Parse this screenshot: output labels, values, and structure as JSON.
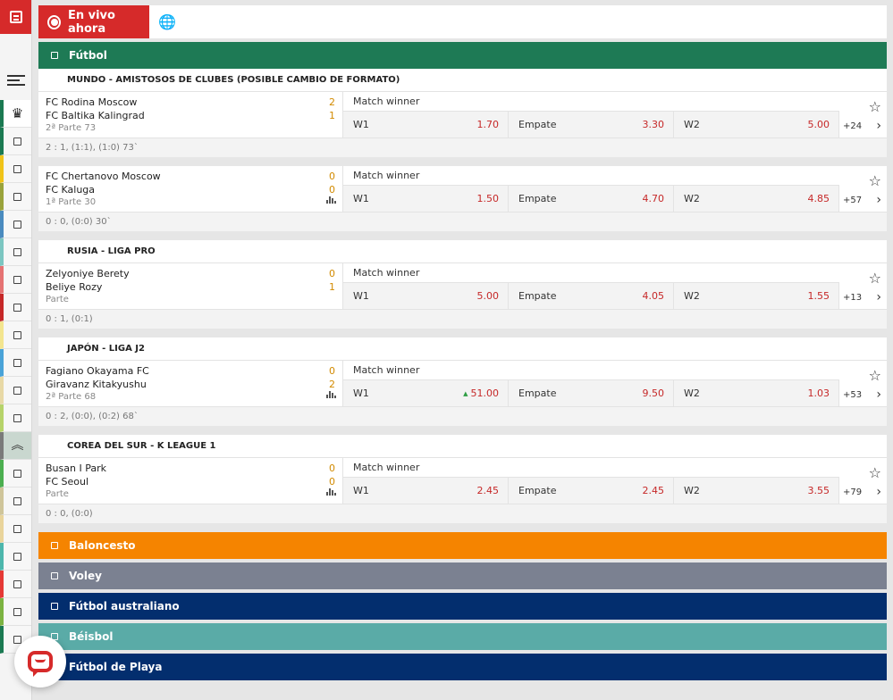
{
  "live": {
    "label": "En vivo ahora"
  },
  "sports": [
    {
      "name": "Fútbol",
      "color": "#1e7a55"
    },
    {
      "name": "Baloncesto",
      "color": "#f58400"
    },
    {
      "name": "Voley",
      "color": "#7b8191"
    },
    {
      "name": "Fútbol australiano",
      "color": "#032e6e"
    },
    {
      "name": "Béisbol",
      "color": "#5aaba7"
    },
    {
      "name": "Fútbol de Playa",
      "color": "#032e6e"
    }
  ],
  "market_label": "Match winner",
  "labels": {
    "w1": "W1",
    "draw": "Empate",
    "w2": "W2"
  },
  "leagues": [
    {
      "title": "MUNDO - AMISTOSOS DE CLUBES (POSIBLE CAMBIO DE FORMATO)"
    },
    {
      "title": "RUSIA - LIGA PRO"
    },
    {
      "title": "JAPÓN - LIGA J2"
    },
    {
      "title": "COREA DEL SUR - K LEAGUE 1"
    }
  ],
  "matches": [
    {
      "home": "FC Rodina Moscow",
      "away": "FC Baltika Kalingrad",
      "home_score": "2",
      "away_score": "1",
      "period": "2ª Parte   73",
      "w1": "1.70",
      "draw": "3.30",
      "w2": "5.00",
      "more": "+24",
      "stats": "2 : 1, (1:1), (1:0) 73`"
    },
    {
      "home": "FC Chertanovo Moscow",
      "away": "FC Kaluga",
      "home_score": "0",
      "away_score": "0",
      "period": "1ª Parte   30",
      "w1": "1.50",
      "draw": "4.70",
      "w2": "4.85",
      "more": "+57",
      "stats": "0 : 0, (0:0) 30`"
    },
    {
      "home": "Zelyoniye Berety",
      "away": "Beliye Rozy",
      "home_score": "0",
      "away_score": "1",
      "period": "Parte",
      "w1": "5.00",
      "draw": "4.05",
      "w2": "1.55",
      "more": "+13",
      "stats": "0 : 1, (0:1)"
    },
    {
      "home": "Fagiano Okayama FC",
      "away": "Giravanz Kitakyushu",
      "home_score": "0",
      "away_score": "2",
      "period": "2ª Parte   68",
      "w1": "51.00",
      "draw": "9.50",
      "w2": "1.03",
      "more": "+53",
      "stats": "0 : 2, (0:0), (0:2) 68`"
    },
    {
      "home": "Busan I Park",
      "away": "FC Seoul",
      "home_score": "0",
      "away_score": "0",
      "period": "Parte",
      "w1": "2.45",
      "draw": "2.45",
      "w2": "3.55",
      "more": "+79",
      "stats": "0 : 0, (0:0)"
    }
  ],
  "sidebar_colors": [
    "#1b7a52",
    "#f0c419",
    "#9aa33c",
    "#4a8bbf",
    "#7cc6c1",
    "#e57373",
    "#c62828",
    "#f3e58f",
    "#4aa3d8",
    "#e8d9a6",
    "#b6d36a",
    "#7a7a7a",
    "#4caf50",
    "#cfc59a",
    "#e9d49b",
    "#4db6ac",
    "#e53935",
    "#7cb342",
    "#1b7a52"
  ],
  "icons": [
    "document-icon",
    "menu-icon",
    "trophy-icon",
    "globe-icon",
    "star-icon",
    "chevron-right-icon",
    "stats-icon",
    "chat-icon"
  ]
}
